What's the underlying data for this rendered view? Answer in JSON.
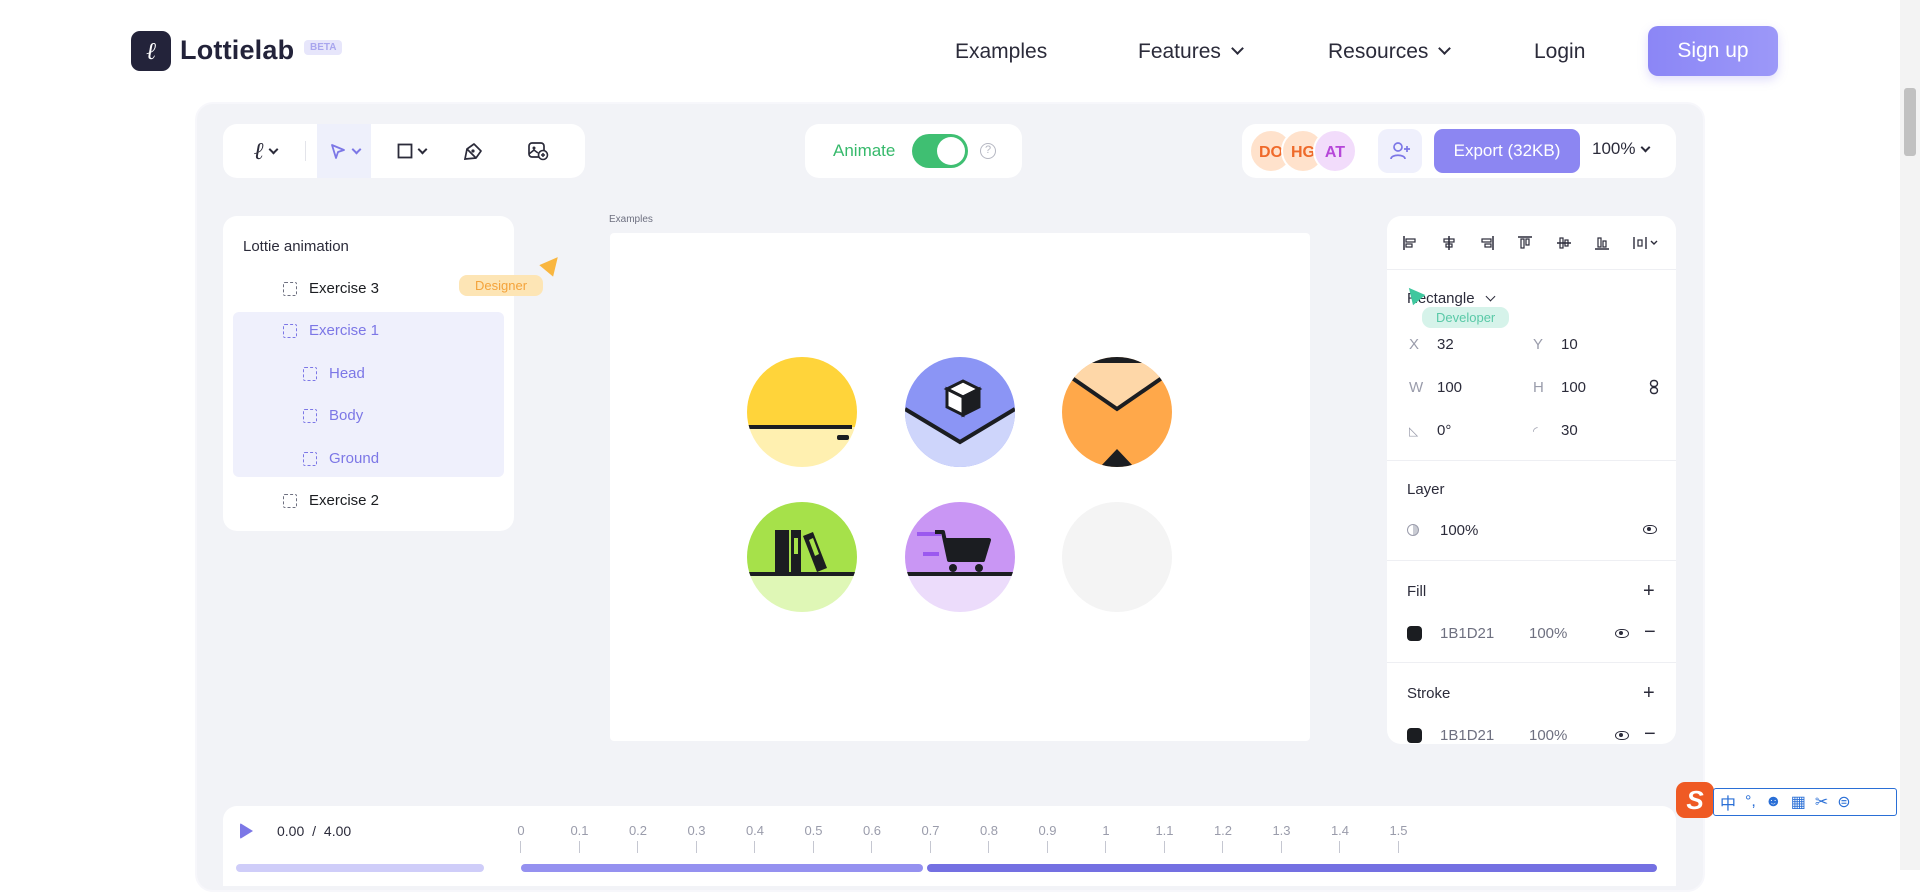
{
  "nav": {
    "logo_mark": "ℓ",
    "logo_text": "Lottielab",
    "beta": "BETA",
    "links": [
      {
        "label": "Examples"
      },
      {
        "label": "Features"
      },
      {
        "label": "Resources"
      },
      {
        "label": "Login"
      }
    ],
    "signup": "Sign up"
  },
  "toolbar": {
    "animate_label": "Animate",
    "animate_on": true,
    "help": "?",
    "avatars": [
      {
        "initials": "DO",
        "bg": "#ffe2cc",
        "fg": "#f06a2a"
      },
      {
        "initials": "HG",
        "bg": "#ffe2cc",
        "fg": "#ee6a2a"
      },
      {
        "initials": "AT",
        "bg": "#f2dcfb",
        "fg": "#b646d9"
      }
    ],
    "export_label": "Export (32KB)",
    "zoom": "100%"
  },
  "layers": {
    "title": "Lottie animation",
    "items": [
      {
        "label": "Exercise 3",
        "selected": false
      },
      {
        "label": "Exercise 1",
        "selected": true
      },
      {
        "label": "Head",
        "selected": true
      },
      {
        "label": "Body",
        "selected": true
      },
      {
        "label": "Ground",
        "selected": true
      },
      {
        "label": "Exercise 2",
        "selected": false
      }
    ]
  },
  "collaborators": {
    "designer": "Designer",
    "developer": "Developer"
  },
  "canvas": {
    "label": "Examples",
    "icons": [
      {
        "name": "sunset-icon",
        "top": "#ffd43a",
        "bottom": "#fff0b0"
      },
      {
        "name": "box-icon",
        "top": "#8b95f5",
        "bottom": "#ced5fb"
      },
      {
        "name": "envelope-icon",
        "top": "#ffa84a",
        "bottom": "#ffa84a"
      },
      {
        "name": "books-icon",
        "top": "#a6e14a",
        "bottom": "#dff7b6"
      },
      {
        "name": "cart-icon",
        "top": "#c996f4",
        "bottom": "#ecdcfb"
      },
      {
        "name": "empty-placeholder",
        "top": "#f4f4f4",
        "bottom": "#f4f4f4"
      }
    ]
  },
  "props": {
    "shape_type": "Rectangle",
    "x_label": "X",
    "x": "32",
    "y_label": "Y",
    "y": "10",
    "w_label": "W",
    "w": "100",
    "h_label": "H",
    "h": "100",
    "rotation": "0°",
    "radius": "30",
    "layer_title": "Layer",
    "layer_opacity": "100%",
    "fill_title": "Fill",
    "fill_hex": "1B1D21",
    "fill_opacity": "100%",
    "stroke_title": "Stroke",
    "stroke_hex": "1B1D21",
    "stroke_opacity": "100%"
  },
  "timeline": {
    "current": "0.00",
    "separator": "/",
    "duration": "4.00",
    "ticks": [
      "0",
      "0.1",
      "0.2",
      "0.3",
      "0.4",
      "0.5",
      "0.6",
      "0.7",
      "0.8",
      "0.9",
      "1",
      "1.1",
      "1.2",
      "1.3",
      "1.4",
      "1.5"
    ]
  },
  "ime": {
    "logo": "S",
    "lang": "中",
    "punct": "°,"
  },
  "colors": {
    "accent": "#8c86f2",
    "toggle_green": "#3fbf72",
    "frame_bg": "#f2f3f7",
    "designer": "#f9b640",
    "developer": "#3fc79e"
  }
}
